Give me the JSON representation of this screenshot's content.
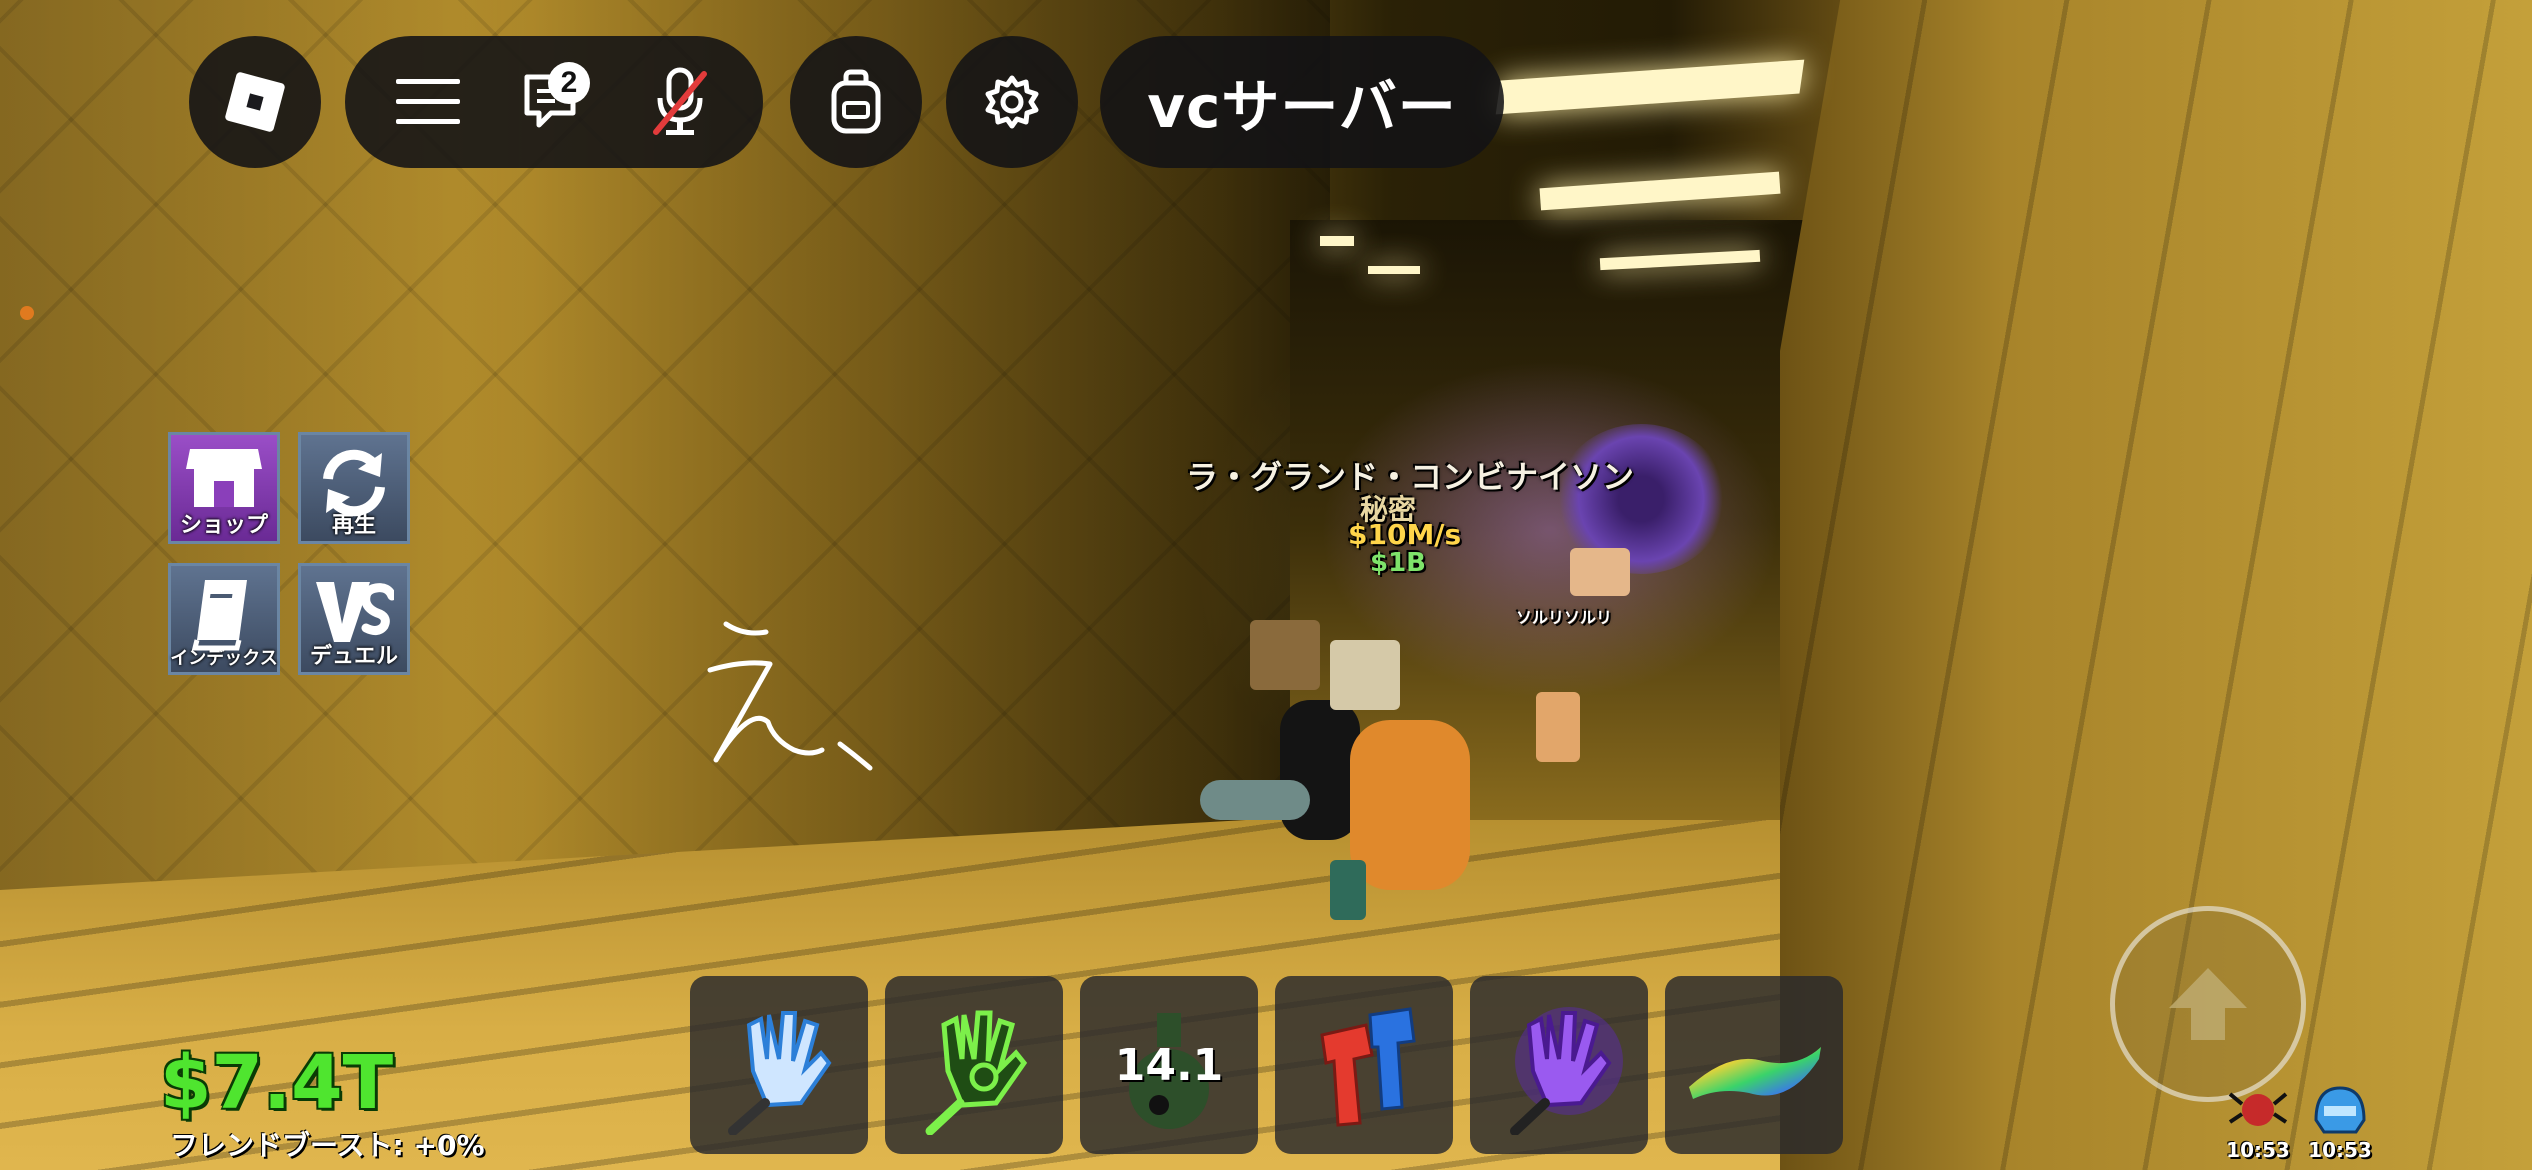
{
  "topbar": {
    "chat_badge": "2",
    "server_name": "vcサーバー"
  },
  "side_menu": {
    "shop_label": "ショップ",
    "replay_label": "再生",
    "index_label": "インデックス",
    "duel_label": "デュエル"
  },
  "doodle_text": "え、",
  "overhead": {
    "name": "ラ・グランド・コンビナイソン",
    "rarity": "秘密",
    "rate": "$10M/s",
    "price": "$1B",
    "other_name": "ソルリソルリ"
  },
  "hotbar": {
    "slots": [
      {
        "icon": "blue-glove-icon"
      },
      {
        "icon": "biohazard-glove-icon"
      },
      {
        "icon": "potion-icon",
        "label": "14.1"
      },
      {
        "icon": "red-blue-glove-icon"
      },
      {
        "icon": "purple-glove-icon"
      },
      {
        "icon": "rainbow-carpet-icon"
      }
    ]
  },
  "stats": {
    "money": "$7.4T",
    "friend_boost": "フレンドブースト: +0%"
  },
  "effects": [
    {
      "icon": "red-spider-icon",
      "time": "10:53"
    },
    {
      "icon": "blue-helmet-icon",
      "time": "10:53"
    }
  ],
  "colors": {
    "money": "#4fe52f",
    "shop_tile": "#9a4ec7",
    "menu_tile": "#5f7390",
    "pill_bg": "#121216"
  }
}
